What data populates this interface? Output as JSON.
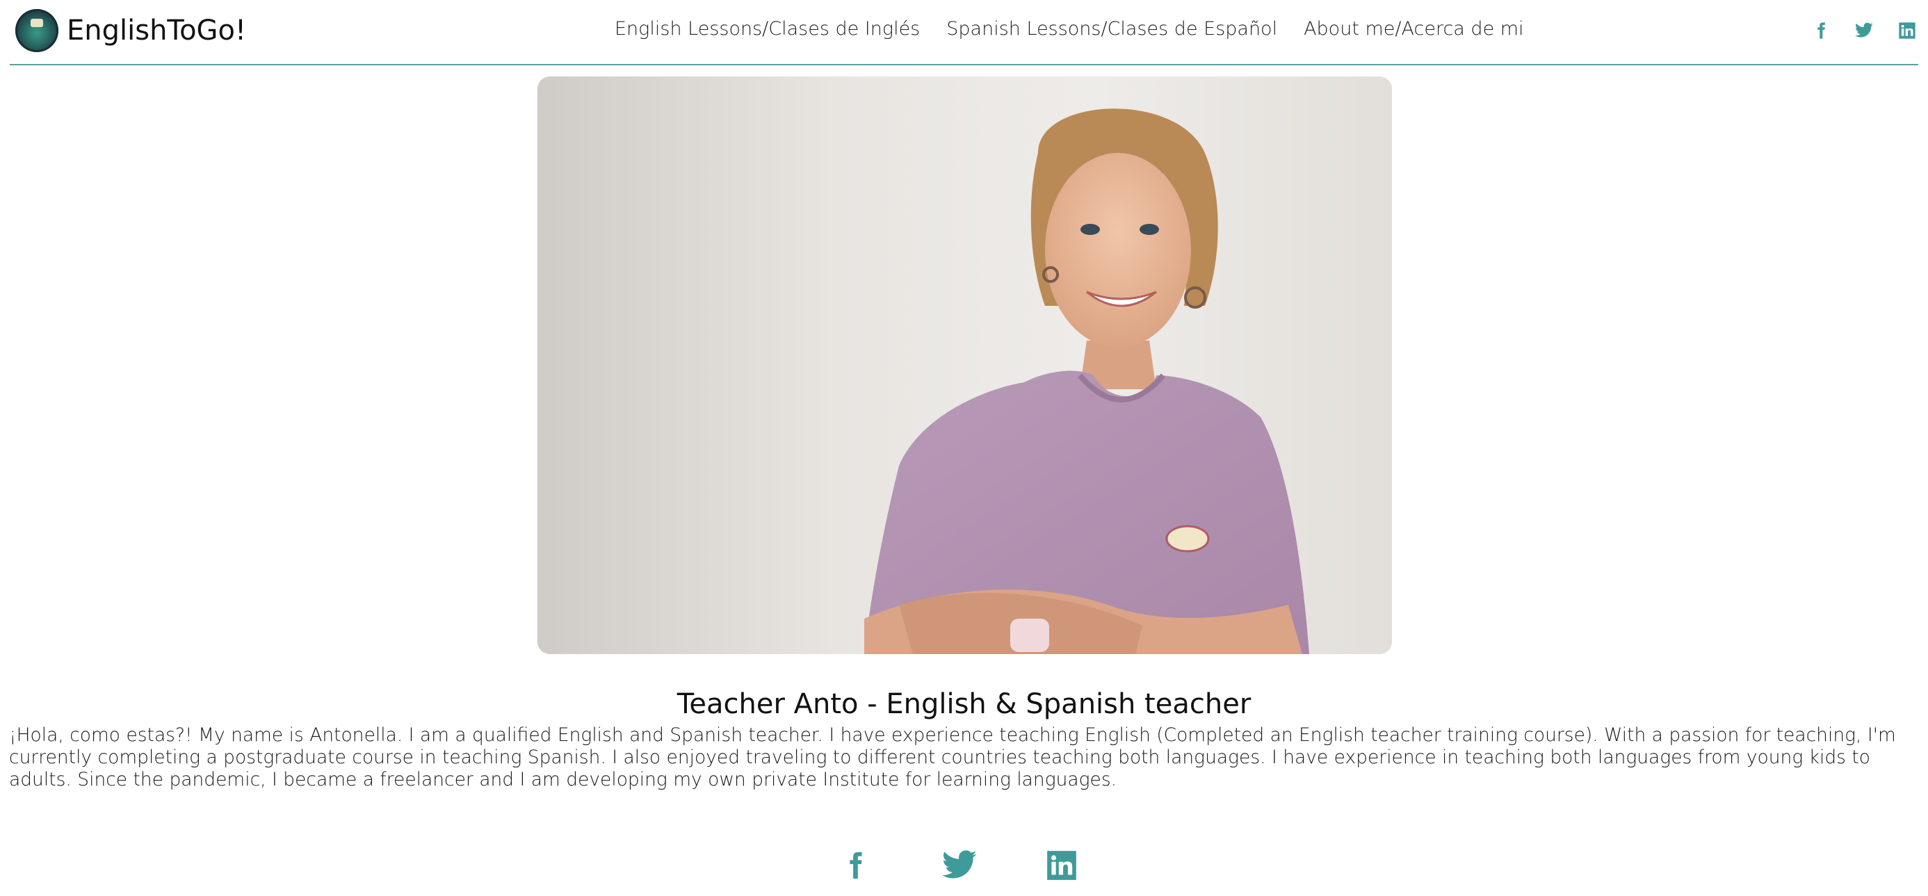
{
  "brand": {
    "name": "EnglishToGo!"
  },
  "nav": {
    "items": [
      {
        "label": "English Lessons/Clases de Inglés"
      },
      {
        "label": "Spanish Lessons/Clases de Español"
      },
      {
        "label": "About me/Acerca de mi"
      }
    ]
  },
  "social": {
    "icons": [
      "facebook-icon",
      "twitter-icon",
      "linkedin-icon"
    ],
    "color": "#3f9a9a"
  },
  "profile": {
    "title": "Teacher Anto - English & Spanish teacher",
    "bio": "¡Hola, como estas?! My name is Antonella. I am a qualified English and Spanish teacher. I have experience teaching English (Completed an English teacher training course). With a passion for teaching, I'm currently completing a postgraduate course in teaching Spanish. I also enjoyed traveling to different countries teaching both languages. I have experience in teaching both languages from young kids to adults. Since the pandemic, I became a freelancer and I am developing my own private Institute for learning languages."
  },
  "theme": {
    "accent": "#3f9a9a",
    "divider": "#5aa1a1"
  }
}
